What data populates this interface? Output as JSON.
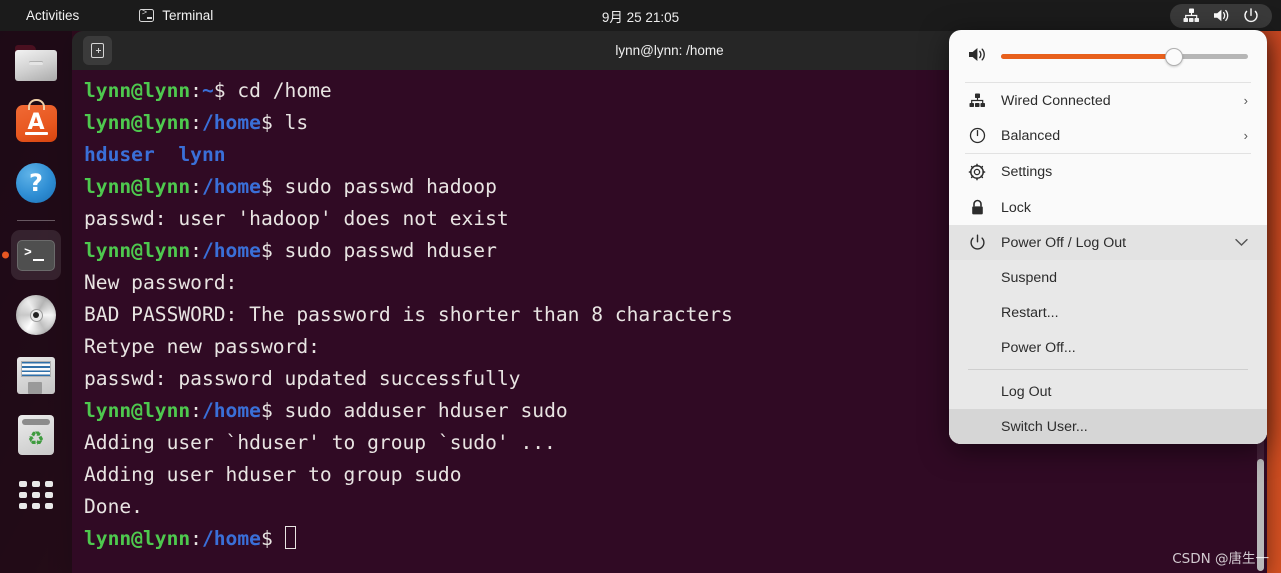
{
  "topbar": {
    "activities": "Activities",
    "app_name": "Terminal",
    "app_icon": "terminal-icon",
    "clock": "9月 25  21:05",
    "status_icons": [
      "network-wired-icon",
      "volume-icon",
      "power-icon"
    ]
  },
  "dock": {
    "items": [
      {
        "name": "files",
        "icon": "folder-icon",
        "active": false
      },
      {
        "name": "ubuntu-software",
        "icon": "software-bag-icon",
        "letter": "A",
        "active": false
      },
      {
        "name": "help",
        "icon": "question-mark-icon",
        "letter": "?",
        "active": false
      },
      {
        "name": "terminal",
        "icon": "terminal-icon",
        "active": true
      },
      {
        "name": "cd-drive",
        "icon": "disc-icon",
        "active": false
      },
      {
        "name": "floppy-drive",
        "icon": "floppy-disk-icon",
        "active": false
      },
      {
        "name": "trash",
        "icon": "trash-recycle-icon",
        "active": false
      },
      {
        "name": "show-applications",
        "icon": "grid-apps-icon",
        "active": false
      }
    ]
  },
  "terminal": {
    "title": "lynn@lynn: /home",
    "new_tab_label": "new-tab",
    "prompt_user": "lynn@lynn",
    "lines": [
      {
        "type": "prompt",
        "user": "lynn@lynn",
        "path": "~",
        "cmd": " cd /home"
      },
      {
        "type": "prompt",
        "user": "lynn@lynn",
        "path": "/home",
        "cmd": " ls"
      },
      {
        "type": "dirlist",
        "text": "hduser  lynn"
      },
      {
        "type": "prompt",
        "user": "lynn@lynn",
        "path": "/home",
        "cmd": " sudo passwd hadoop"
      },
      {
        "type": "output",
        "text": "passwd: user 'hadoop' does not exist"
      },
      {
        "type": "prompt",
        "user": "lynn@lynn",
        "path": "/home",
        "cmd": " sudo passwd hduser"
      },
      {
        "type": "output",
        "text": "New password:"
      },
      {
        "type": "output",
        "text": "BAD PASSWORD: The password is shorter than 8 characters"
      },
      {
        "type": "output",
        "text": "Retype new password:"
      },
      {
        "type": "output",
        "text": "passwd: password updated successfully"
      },
      {
        "type": "prompt",
        "user": "lynn@lynn",
        "path": "/home",
        "cmd": " sudo adduser hduser sudo"
      },
      {
        "type": "output",
        "text": "Adding user `hduser' to group `sudo' ..."
      },
      {
        "type": "output",
        "text": "Adding user hduser to group sudo"
      },
      {
        "type": "output",
        "text": "Done."
      },
      {
        "type": "prompt-cursor",
        "user": "lynn@lynn",
        "path": "/home",
        "cmd": " "
      }
    ]
  },
  "system_menu": {
    "volume": {
      "icon": "volume-icon",
      "value": 70
    },
    "items": [
      {
        "label": "Wired Connected",
        "icon": "network-wired-icon",
        "chevron": "›"
      },
      {
        "label": "Balanced",
        "icon": "power-profile-icon",
        "chevron": "›"
      },
      {
        "label": "Settings",
        "icon": "gear-icon"
      },
      {
        "label": "Lock",
        "icon": "lock-icon"
      },
      {
        "label": "Power Off / Log Out",
        "icon": "power-icon",
        "chevron": "⌄",
        "expanded": true
      }
    ],
    "submenu": [
      {
        "label": "Suspend"
      },
      {
        "label": "Restart..."
      },
      {
        "label": "Power Off..."
      },
      {
        "label": "Log Out"
      },
      {
        "label": "Switch User...",
        "hovered": true
      }
    ],
    "accent_color": "#e8601c"
  },
  "watermark": "CSDN @唐生一"
}
